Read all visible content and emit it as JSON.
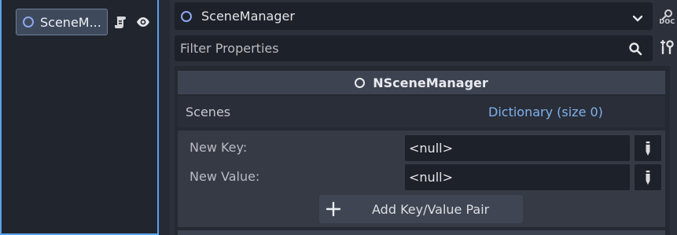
{
  "scene_tree": {
    "node_label": "SceneM...",
    "node_icon": "node-circle-icon",
    "script_icon": "script-icon",
    "visibility_icon": "eye-icon"
  },
  "inspector": {
    "object_name": "SceneManager",
    "doc_button_label": "DOC",
    "filter_placeholder": "Filter Properties",
    "class_name": "NSceneManager",
    "property": {
      "name": "Scenes",
      "value": "Dictionary (size 0)"
    },
    "dictionary_editor": {
      "new_key_label": "New Key:",
      "new_key_value": "<null>",
      "new_value_label": "New Value:",
      "new_value_value": "<null>",
      "add_pair_label": "Add Key/Value Pair"
    }
  },
  "colors": {
    "accent_blue": "#5aa2ec",
    "node_icon": "#8da6f0",
    "link_value": "#7fb1ef",
    "panel_dark": "#1d2129"
  }
}
